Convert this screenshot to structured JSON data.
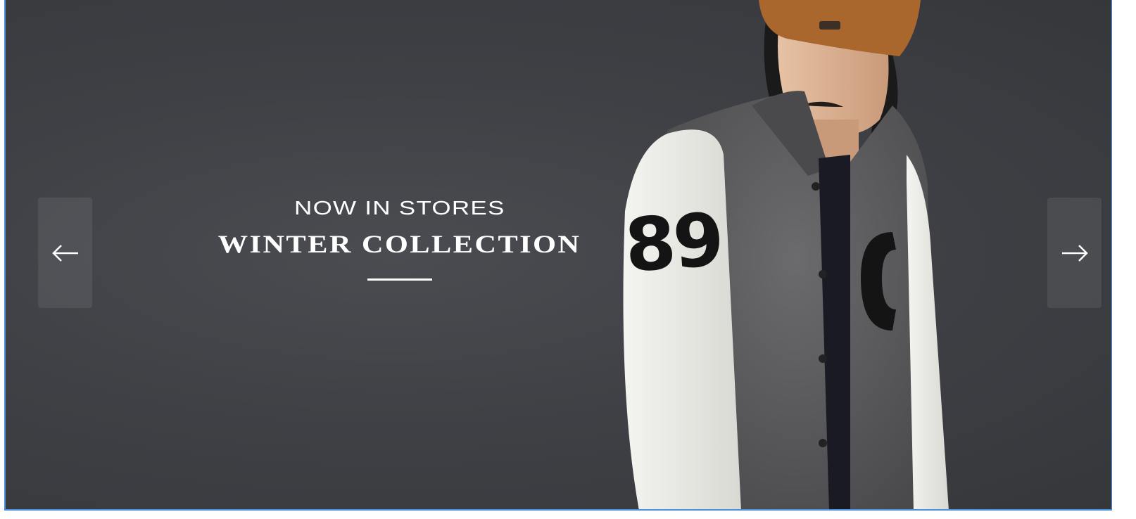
{
  "hero": {
    "subtitle": "NOW IN STORES",
    "title": "WINTER COLLECTION"
  },
  "controls": {
    "prev_icon": "arrow-left-icon",
    "next_icon": "arrow-right-icon"
  },
  "image": {
    "jacket_number": "89",
    "jacket_letter": "C"
  },
  "colors": {
    "background": "#3f4146",
    "text": "#ffffff",
    "frame_border": "#4a90e2",
    "cap": "#a9672d",
    "jacket_body": "#5b5b5d",
    "sleeve": "#efefeb"
  }
}
